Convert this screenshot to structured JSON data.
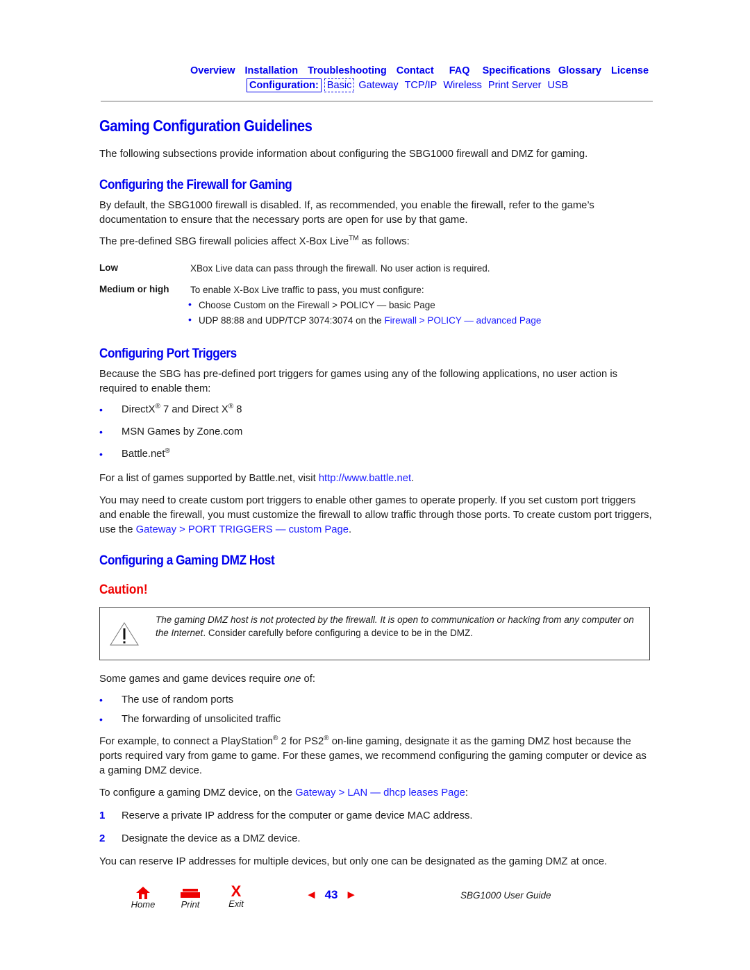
{
  "nav": {
    "primary": [
      "Overview",
      "Installation",
      "Troubleshooting",
      "Contact",
      "FAQ",
      "Specifications",
      "Glossary",
      "License"
    ],
    "config_label": "Configuration:",
    "secondary_active": "Basic",
    "secondary": [
      "Gateway",
      "TCP/IP",
      "Wireless",
      "Print Server",
      "USB"
    ]
  },
  "page_title": "Gaming Configuration Guidelines",
  "intro": "The following subsections provide information about configuring the SBG1000 firewall and DMZ for gaming.",
  "firewall": {
    "heading": "Configuring the Firewall for Gaming",
    "para1": "By default, the SBG1000 firewall is disabled. If, as recommended, you enable the firewall, refer to the game’s documentation to ensure that the necessary ports are open for use by that game.",
    "para2_before": "The pre-defined SBG firewall policies affect X-Box Live",
    "para2_sup": "TM",
    "para2_after": " as follows:",
    "low_term": "Low",
    "low_def": "XBox Live data can pass through the firewall. No user action is required.",
    "med_term": "Medium or high",
    "med_def": "To enable X-Box Live traffic to pass, you must configure:",
    "med_bullets": [
      {
        "text": "Choose Custom on the Firewall > POLICY — basic Page"
      },
      {
        "text": "UDP 88:88 and UDP/TCP 3074:3074 on  the ",
        "link": "Firewall > POLICY — advanced Page"
      }
    ]
  },
  "port_triggers": {
    "heading": "Configuring Port Triggers",
    "para1": "Because the SBG has pre-defined port triggers for games using any of the following applications, no user action is required to enable them:",
    "bullets": [
      {
        "a": "DirectX",
        "sup1": "®",
        "b": " 7 and Direct X",
        "sup2": "®",
        "c": " 8"
      },
      {
        "a": "MSN Games by Zone.com"
      },
      {
        "a": "Battle.net",
        "sup1": "®"
      }
    ],
    "battlenet_text": "For a list of games supported by Battle.net, visit ",
    "battlenet_link": "http://www.battle.net",
    "battlenet_end": ".",
    "custom_text": "You may need to create custom port triggers to enable other games to operate properly. If you set custom port triggers and enable the firewall, you must customize the firewall to allow traffic through those ports. To create custom port triggers, use the ",
    "custom_link": "Gateway > PORT TRIGGERS — custom Page",
    "custom_end": "."
  },
  "dmz": {
    "heading": "Configuring a Gaming DMZ Host",
    "caution_label": "Caution!",
    "caution_italic": "The gaming DMZ host is not protected by the firewall. It is open to communication or hacking from any computer on the Internet",
    "caution_rest": ". Consider carefully before configuring a device to be in the DMZ.",
    "require_before": "Some games and game devices require ",
    "require_em": "one",
    "require_after": " of:",
    "bullets": [
      "The use of random ports",
      "The forwarding of unsolicited traffic"
    ],
    "example_a": "For example, to connect a PlayStation",
    "example_sup1": "®",
    "example_b": " 2 for PS2",
    "example_sup2": "®",
    "example_c": " on-line gaming, designate it as the gaming DMZ host because the ports required vary from game to game. For these games, we recommend configuring the gaming computer or device as a gaming DMZ device.",
    "configure_text": "To configure a gaming DMZ device, on the ",
    "configure_link": "Gateway > LAN — dhcp leases Page",
    "configure_end": ":",
    "steps": [
      {
        "num": "1",
        "text": "Reserve a private IP address for the computer or game device MAC address."
      },
      {
        "num": "2",
        "text": "Designate the device as a DMZ device."
      }
    ],
    "closing": "You can reserve IP addresses for multiple devices, but only one can be designated as the gaming DMZ at once."
  },
  "footer": {
    "home": "Home",
    "print": "Print",
    "exit": "Exit",
    "exit_glyph": "X",
    "page_number": "43",
    "prev_glyph": "◄",
    "next_glyph": "►",
    "guide_title": "SBG1000 User Guide"
  },
  "colors": {
    "link": "#0000ee",
    "caution": "#ee0000",
    "footer_icons": "#ee0000"
  }
}
